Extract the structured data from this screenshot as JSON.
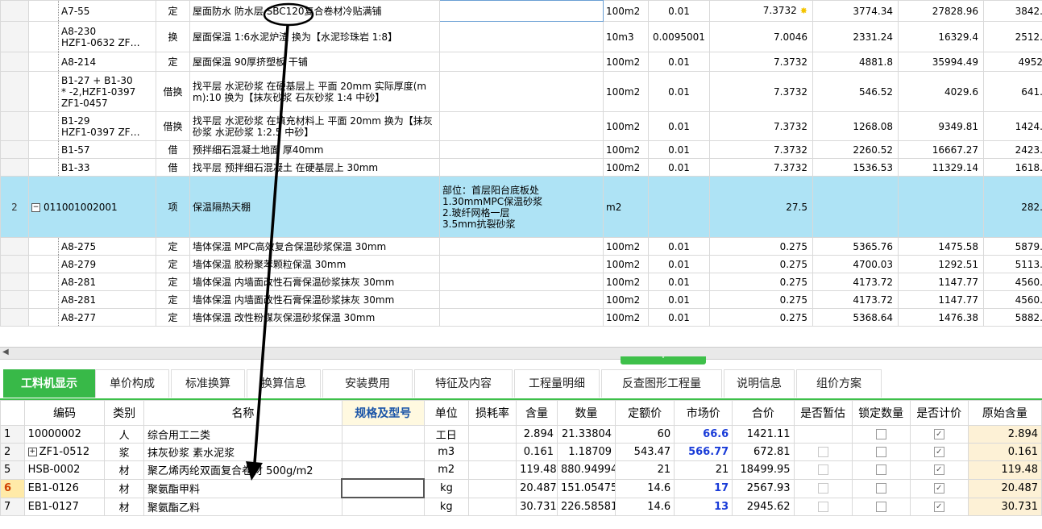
{
  "top_grid": {
    "rows": [
      {
        "idx": "",
        "code": "A7-55",
        "type": "定",
        "name": "屋面防水 防水层 SBC120复合卷材冷贴满铺",
        "desc": "",
        "unit": "100m2",
        "content": "0.01",
        "qty": "7.3732",
        "price": "3774.34",
        "total": "27828.96",
        "extra": "3842."
      },
      {
        "idx": "",
        "code": "A8-230\nHZF1-0632 ZF…",
        "type": "换",
        "name": "屋面保温 1:6水泥炉渣 换为【水泥珍珠岩 1:8】",
        "desc": "",
        "unit": "10m3",
        "content": "0.0095001",
        "qty": "7.0046",
        "price": "2331.24",
        "total": "16329.4",
        "extra": "2512."
      },
      {
        "idx": "",
        "code": "A8-214",
        "type": "定",
        "name": "屋面保温 90厚挤塑板 干铺",
        "desc": "",
        "unit": "100m2",
        "content": "0.01",
        "qty": "7.3732",
        "price": "4881.8",
        "total": "35994.49",
        "extra": "4952"
      },
      {
        "idx": "",
        "code": "B1-27 + B1-30\n* -2,HZF1-0397\nZF1-0457",
        "type": "借换",
        "name": "找平层 水泥砂浆 在硬基层上 平面 20mm 实际厚度(mm):10 换为【抹灰砂浆 石灰砂浆 1:4 中砂】",
        "desc": "",
        "unit": "100m2",
        "content": "0.01",
        "qty": "7.3732",
        "price": "546.52",
        "total": "4029.6",
        "extra": "641."
      },
      {
        "idx": "",
        "code": "B1-29\nHZF1-0397 ZF…",
        "type": "借换",
        "name": "找平层 水泥砂浆 在填充材料上 平面 20mm 换为【抹灰砂浆 水泥砂浆 1:2.5 中砂】",
        "desc": "",
        "unit": "100m2",
        "content": "0.01",
        "qty": "7.3732",
        "price": "1268.08",
        "total": "9349.81",
        "extra": "1424."
      },
      {
        "idx": "",
        "code": "B1-57",
        "type": "借",
        "name": "预拌细石混凝土地面 厚40mm",
        "desc": "",
        "unit": "100m2",
        "content": "0.01",
        "qty": "7.3732",
        "price": "2260.52",
        "total": "16667.27",
        "extra": "2423."
      },
      {
        "idx": "",
        "code": "B1-33",
        "type": "借",
        "name": "找平层 预拌细石混凝土 在硬基层上 30mm",
        "desc": "",
        "unit": "100m2",
        "content": "0.01",
        "qty": "7.3732",
        "price": "1536.53",
        "total": "11329.14",
        "extra": "1618."
      },
      {
        "idx": "2",
        "code": "011001002001",
        "type": "项",
        "name": "保温隔热天棚",
        "desc": "部位：首层阳台底板处\n1.30mmMPC保温砂浆\n2.玻纤网格一层\n3.5mm抗裂砂浆",
        "unit": "m2",
        "content": "",
        "qty": "27.5",
        "price": "",
        "total": "",
        "extra": "282."
      },
      {
        "idx": "",
        "code": "A8-275",
        "type": "定",
        "name": "墙体保温 MPC高效复合保温砂浆保温 30mm",
        "desc": "",
        "unit": "100m2",
        "content": "0.01",
        "qty": "0.275",
        "price": "5365.76",
        "total": "1475.58",
        "extra": "5879."
      },
      {
        "idx": "",
        "code": "A8-279",
        "type": "定",
        "name": "墙体保温 胶粉聚苯颗粒保温 30mm",
        "desc": "",
        "unit": "100m2",
        "content": "0.01",
        "qty": "0.275",
        "price": "4700.03",
        "total": "1292.51",
        "extra": "5113."
      },
      {
        "idx": "",
        "code": "A8-281",
        "type": "定",
        "name": "墙体保温 内墙面改性石膏保温砂浆抹灰 30mm",
        "desc": "",
        "unit": "100m2",
        "content": "0.01",
        "qty": "0.275",
        "price": "4173.72",
        "total": "1147.77",
        "extra": "4560."
      },
      {
        "idx": "",
        "code": "A8-281",
        "type": "定",
        "name": "墙体保温 内墙面改性石膏保温砂浆抹灰 30mm",
        "desc": "",
        "unit": "100m2",
        "content": "0.01",
        "qty": "0.275",
        "price": "4173.72",
        "total": "1147.77",
        "extra": "4560."
      },
      {
        "idx": "",
        "code": "A8-277",
        "type": "定",
        "name": "墙体保温 改性粉煤灰保温砂浆保温 30mm",
        "desc": "",
        "unit": "100m2",
        "content": "0.01",
        "qty": "0.275",
        "price": "5368.64",
        "total": "1476.38",
        "extra": "5882."
      }
    ]
  },
  "tabs": [
    {
      "label": "工料机显示",
      "active": true
    },
    {
      "label": "单价构成"
    },
    {
      "label": "标准换算"
    },
    {
      "label": "换算信息"
    },
    {
      "label": "安装费用"
    },
    {
      "label": "特征及内容"
    },
    {
      "label": "工程量明细"
    },
    {
      "label": "反查图形工程量"
    },
    {
      "label": "说明信息"
    },
    {
      "label": "组价方案"
    }
  ],
  "bottom_grid": {
    "headers": [
      "",
      "编码",
      "类别",
      "名称",
      "规格及型号",
      "单位",
      "损耗率",
      "含量",
      "数量",
      "定额价",
      "市场价",
      "合价",
      "是否暂估",
      "锁定数量",
      "是否计价",
      "原始含量"
    ],
    "rows": [
      {
        "idx": "1",
        "code": "10000002",
        "cat": "人",
        "name": "综合用工二类",
        "spec": "",
        "unit": "工日",
        "loss": "",
        "content": "2.894",
        "qty": "21.33804",
        "quota": "60",
        "market": "66.6",
        "market_hl": true,
        "total": "1421.11",
        "est": "none",
        "lock": "off",
        "priced": "on",
        "orig": "2.894"
      },
      {
        "idx": "2",
        "code": "ZF1-0512",
        "cat": "浆",
        "name": "抹灰砂浆 素水泥浆",
        "spec": "",
        "unit": "m3",
        "loss": "",
        "content": "0.161",
        "qty": "1.18709",
        "quota": "543.47",
        "market": "566.77",
        "market_hl": true,
        "total": "672.81",
        "est": "dis",
        "lock": "off",
        "priced": "on",
        "orig": "0.161",
        "expand": true
      },
      {
        "idx": "5",
        "code": "HSB-0002",
        "cat": "材",
        "name": "聚乙烯丙纶双面复合卷材 500g/m2",
        "spec": "",
        "unit": "m2",
        "loss": "",
        "content": "119.48",
        "qty": "880.94994",
        "quota": "21",
        "market": "21",
        "market_hl": false,
        "total": "18499.95",
        "est": "dis",
        "lock": "off",
        "priced": "on",
        "orig": "119.48"
      },
      {
        "idx": "6",
        "code": "EB1-0126",
        "cat": "材",
        "name": "聚氨酯甲料",
        "spec": "",
        "unit": "kg",
        "loss": "",
        "content": "20.487",
        "qty": "151.05475",
        "quota": "14.6",
        "market": "17",
        "market_hl": true,
        "total": "2567.93",
        "est": "dis",
        "lock": "off",
        "priced": "on",
        "orig": "20.487",
        "selected": true
      },
      {
        "idx": "7",
        "code": "EB1-0127",
        "cat": "材",
        "name": "聚氨酯乙料",
        "spec": "",
        "unit": "kg",
        "loss": "",
        "content": "30.731",
        "qty": "226.58581",
        "quota": "14.6",
        "market": "13",
        "market_hl": true,
        "total": "2945.62",
        "est": "dis",
        "lock": "off",
        "priced": "on",
        "orig": "30.731"
      }
    ]
  },
  "icons": {
    "star": "star-icon",
    "collapse": "collapse-icon",
    "expand": "expand-icon",
    "scroll_left": "scroll-left-icon",
    "splitter": "splitter-chevron-icon"
  },
  "colors": {
    "tab_active": "#38b948",
    "parent_row": "#aee3f5",
    "market_highlight": "#1a3cd8",
    "annotation": "#000000"
  }
}
